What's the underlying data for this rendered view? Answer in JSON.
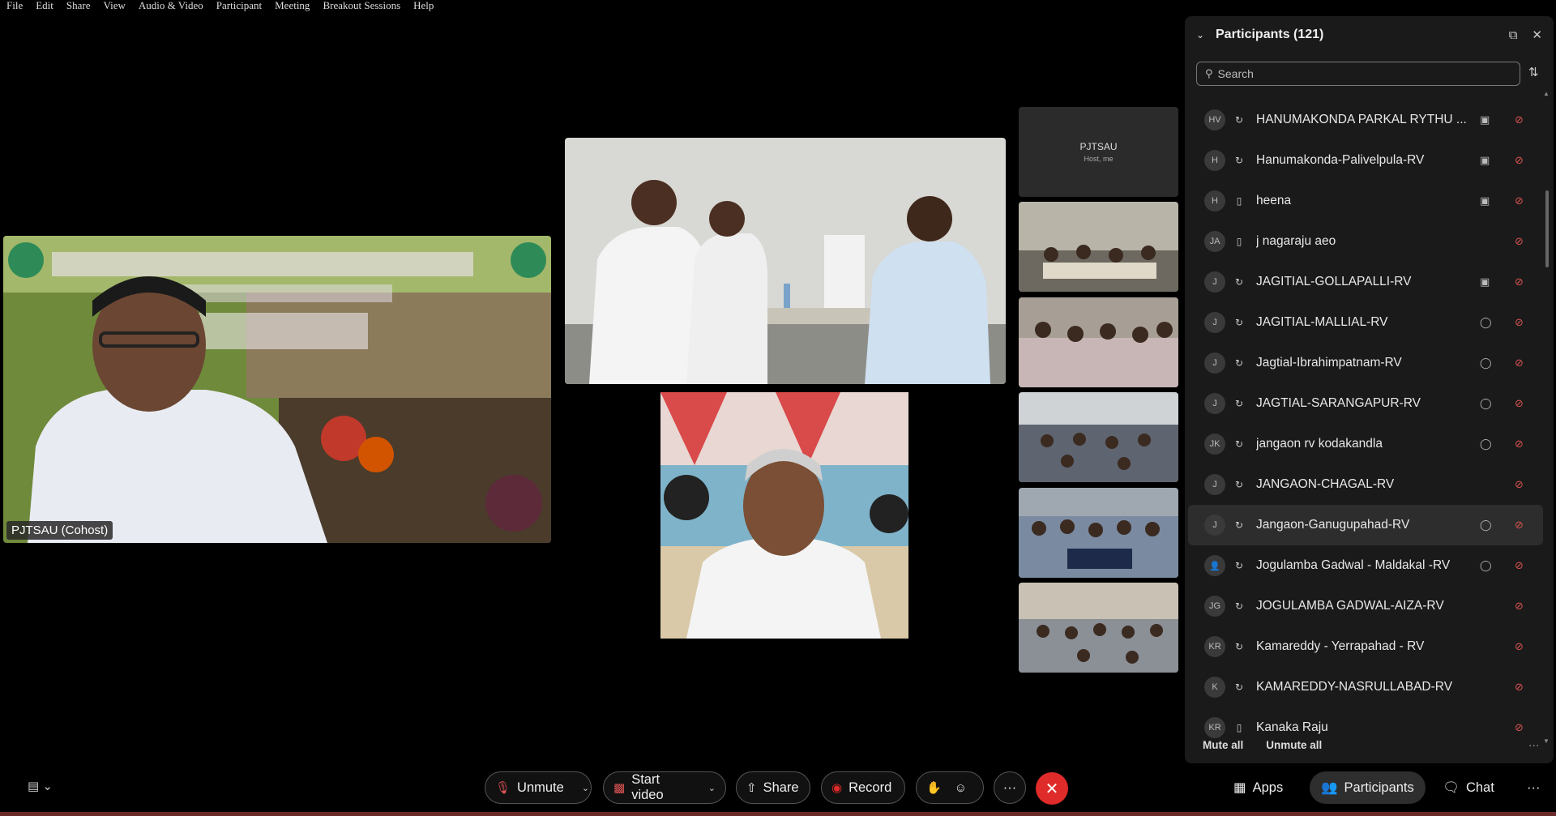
{
  "menu": [
    "File",
    "Edit",
    "Share",
    "View",
    "Audio & Video",
    "Participant",
    "Meeting",
    "Breakout Sessions",
    "Help"
  ],
  "video": {
    "main_name_tag": "PJTSAU (Cohost)",
    "host_tile": {
      "name": "PJTSAU",
      "role": "Host, me"
    }
  },
  "panel": {
    "title": "Participants (121)",
    "search_placeholder": "Search",
    "participants": [
      {
        "initials": "HV",
        "name": "HANUMAKONDA PARKAL RYTHU ...",
        "device": "sync",
        "video": "camera",
        "muted": true
      },
      {
        "initials": "H",
        "name": "Hanumakonda-Palivelpula-RV",
        "device": "sync",
        "video": "camera",
        "muted": true
      },
      {
        "initials": "H",
        "name": "heena",
        "device": "phone",
        "video": "camera",
        "muted": true
      },
      {
        "initials": "JA",
        "name": "j nagaraju aeo",
        "device": "phone",
        "video": "",
        "muted": true
      },
      {
        "initials": "J",
        "name": "JAGITIAL-GOLLAPALLI-RV",
        "device": "sync",
        "video": "camera",
        "muted": true
      },
      {
        "initials": "J",
        "name": "JAGITIAL-MALLIAL-RV",
        "device": "sync",
        "video": "chat",
        "muted": true
      },
      {
        "initials": "J",
        "name": "Jagtial-Ibrahimpatnam-RV",
        "device": "sync",
        "video": "chat",
        "muted": true
      },
      {
        "initials": "J",
        "name": "JAGTIAL-SARANGAPUR-RV",
        "device": "sync",
        "video": "chat",
        "muted": true
      },
      {
        "initials": "JK",
        "name": "jangaon rv kodakandla",
        "device": "sync",
        "video": "chat",
        "muted": true
      },
      {
        "initials": "J",
        "name": "JANGAON-CHAGAL-RV",
        "device": "sync",
        "video": "",
        "muted": true
      },
      {
        "initials": "J",
        "name": "Jangaon-Ganugupahad-RV",
        "device": "sync",
        "video": "chat",
        "muted": true
      },
      {
        "initials": "",
        "name": "Jogulamba Gadwal - Maldakal -RV",
        "device": "sync",
        "video": "chat",
        "muted": true
      },
      {
        "initials": "JG",
        "name": "JOGULAMBA GADWAL-AIZA-RV",
        "device": "sync",
        "video": "",
        "muted": true
      },
      {
        "initials": "KR",
        "name": "Kamareddy - Yerrapahad - RV",
        "device": "sync",
        "video": "",
        "muted": true
      },
      {
        "initials": "K",
        "name": "KAMAREDDY-NASRULLABAD-RV",
        "device": "sync",
        "video": "",
        "muted": true
      },
      {
        "initials": "KR",
        "name": "Kanaka Raju",
        "device": "phone",
        "video": "",
        "muted": true
      }
    ],
    "mute_all": "Mute all",
    "unmute_all": "Unmute all",
    "more": "···"
  },
  "toolbar": {
    "unmute": "Unmute",
    "start_video": "Start video",
    "share": "Share",
    "record": "Record",
    "more": "···",
    "apps": "Apps",
    "participants": "Participants",
    "chat": "Chat",
    "overflow": "···"
  },
  "colors": {
    "leave": "#e02b2b",
    "mute_red": "#d9534f",
    "accent": "#2e2e2e"
  }
}
